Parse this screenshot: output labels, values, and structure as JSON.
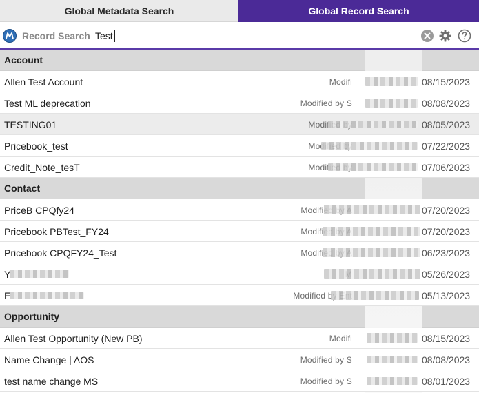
{
  "tabs": {
    "metadata": "Global Metadata Search",
    "record": "Global Record Search"
  },
  "search": {
    "label": "Record Search",
    "value": "Test"
  },
  "groups": [
    {
      "title": "Account",
      "rows": [
        {
          "name": "Allen Test Account",
          "meta": "Modifi",
          "date": "08/15/2023"
        },
        {
          "name": "Test ML deprecation",
          "meta": "Modified by S",
          "date": "08/08/2023"
        },
        {
          "name": "TESTING01",
          "meta": "Modified by",
          "date": "08/05/2023"
        },
        {
          "name": "Pricebook_test",
          "meta": "Modified by",
          "date": "07/22/2023"
        },
        {
          "name": "Credit_Note_tesT",
          "meta": "Modified by",
          "date": "07/06/2023"
        }
      ]
    },
    {
      "title": "Contact",
      "rows": [
        {
          "name": "PriceB CPQfy24",
          "meta": "Modified by A",
          "date": "07/20/2023"
        },
        {
          "name": "Pricebook PBTest_FY24",
          "meta": "Modified by A",
          "date": "07/20/2023"
        },
        {
          "name": "Pricebook CPQFY24_Test",
          "meta": "Modified by A",
          "date": "06/23/2023"
        },
        {
          "name": "Y",
          "meta": "M",
          "date": "05/26/2023"
        },
        {
          "name": "E",
          "meta": "Modified by Ent",
          "date": "05/13/2023"
        }
      ]
    },
    {
      "title": "Opportunity",
      "rows": [
        {
          "name": "Allen Test Opportunity (New PB)",
          "meta": "Modifi",
          "date": "08/15/2023"
        },
        {
          "name": "Name Change | AOS",
          "meta": "Modified by S",
          "date": "08/08/2023"
        },
        {
          "name": "test name change MS",
          "meta": "Modified by S",
          "date": "08/01/2023"
        }
      ]
    }
  ],
  "highlighted_row": "TESTING01",
  "icons": {
    "logo": "app-logo-icon",
    "clear": "clear-circle-icon",
    "settings": "gear-icon",
    "help": "help-circle-icon"
  },
  "colors": {
    "active_tab": "#4b2a97",
    "inactive_tab": "#eaeaea",
    "group_header": "#d9d9d9",
    "highlight_row": "#ececec"
  }
}
